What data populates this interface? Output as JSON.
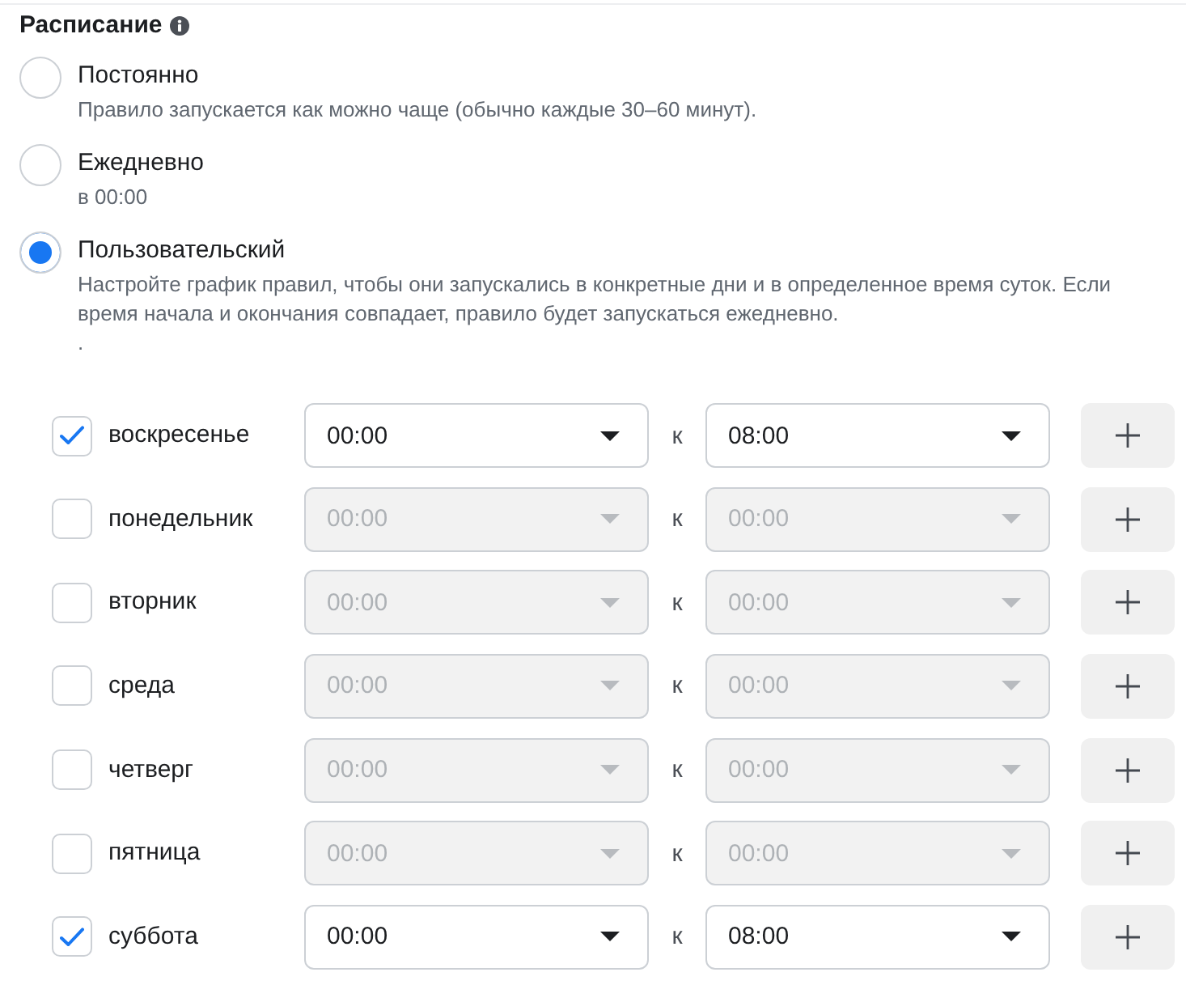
{
  "section": {
    "title": "Расписание"
  },
  "schedule_options": [
    {
      "label": "Постоянно",
      "description": [
        "Правило запускается как можно чаще (обычно каждые 30–60 минут)."
      ],
      "selected": false
    },
    {
      "label": "Ежедневно",
      "description": [
        "в 00:00"
      ],
      "selected": false
    },
    {
      "label": "Пользовательский",
      "description": [
        "Настройте график правил, чтобы они запускались в конкретные дни и в определенное время суток. Если время начала и окончания совпадает, правило будет запускаться ежедневно.",
        "."
      ],
      "selected": true
    }
  ],
  "days": [
    {
      "label": "воскресенье",
      "checked": true,
      "start_time": "00:00",
      "separator": "к",
      "end_time": "08:00"
    },
    {
      "label": "понедельник",
      "checked": false,
      "start_time": "00:00",
      "separator": "к",
      "end_time": "00:00"
    },
    {
      "label": "вторник",
      "checked": false,
      "start_time": "00:00",
      "separator": "к",
      "end_time": "00:00"
    },
    {
      "label": "среда",
      "checked": false,
      "start_time": "00:00",
      "separator": "к",
      "end_time": "00:00"
    },
    {
      "label": "четверг",
      "checked": false,
      "start_time": "00:00",
      "separator": "к",
      "end_time": "00:00"
    },
    {
      "label": "пятница",
      "checked": false,
      "start_time": "00:00",
      "separator": "к",
      "end_time": "00:00"
    },
    {
      "label": "суббота",
      "checked": true,
      "start_time": "00:00",
      "separator": "к",
      "end_time": "08:00"
    }
  ]
}
